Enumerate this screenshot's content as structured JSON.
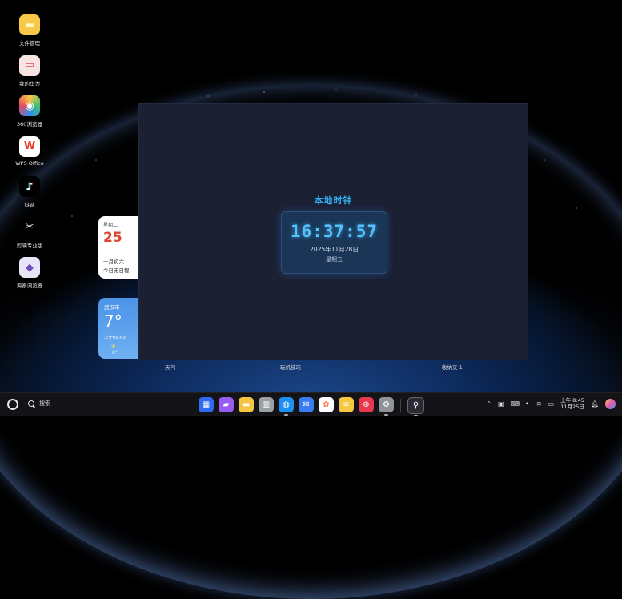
{
  "desktop": {
    "icons": [
      {
        "label": "文件管理",
        "icon": "folder-icon",
        "color": "#f7c948",
        "glyph": "▬"
      },
      {
        "label": "我的华为",
        "icon": "myhuawei-icon",
        "color": "#f7d3d3",
        "glyph": "▭"
      },
      {
        "label": "360浏览器",
        "icon": "360-browser-icon",
        "color": "#ffffff",
        "glyph": "◉"
      },
      {
        "label": "WPS Office",
        "icon": "wps-icon",
        "color": "#e83b2e",
        "glyph": "W"
      },
      {
        "label": "抖音",
        "icon": "douyin-icon",
        "color": "#000000",
        "glyph": "♪"
      },
      {
        "label": "剪映专业版",
        "icon": "capcut-icon",
        "color": "#000000",
        "glyph": "✂"
      },
      {
        "label": "海泰浏览器",
        "icon": "haitai-browser-icon",
        "color": "#6b4fbf",
        "glyph": "◆"
      }
    ]
  },
  "widgets": {
    "calendar": {
      "weekday": "星期二",
      "day": "25",
      "lunar": "十月初六",
      "schedule": "今日无日程"
    },
    "weather": {
      "city": "武汉市",
      "temp": "7°",
      "hour": "上午09:00",
      "hour_temp": "6°"
    },
    "labels": [
      "天气",
      "玩机技巧",
      "收纳夹 1"
    ]
  },
  "clock_app": {
    "title": "本地时钟",
    "time": "16:37:57",
    "date": "2025年11月28日",
    "weekday": "星期五"
  },
  "taskbar": {
    "search_label": "搜索",
    "dock": [
      {
        "icon": "app-gallery-grid-icon",
        "color": "#2f6bf0",
        "glyph": "▦",
        "running": false
      },
      {
        "icon": "files-icon",
        "color": "#9a5cf0",
        "glyph": "▰",
        "running": false
      },
      {
        "icon": "notes-icon",
        "color": "#f6c542",
        "glyph": "▬",
        "running": false
      },
      {
        "icon": "trash-icon",
        "color": "#9aa0a6",
        "glyph": "▥",
        "running": false
      },
      {
        "icon": "browser-icon",
        "color": "#1f8ef1",
        "glyph": "◍",
        "running": true
      },
      {
        "icon": "mail-icon",
        "color": "#3a7df2",
        "glyph": "✉",
        "running": false
      },
      {
        "icon": "photos-icon",
        "color": "#ff7a59",
        "glyph": "✿",
        "running": false
      },
      {
        "icon": "memo-icon",
        "color": "#f5c842",
        "glyph": "≡",
        "running": false
      },
      {
        "icon": "appgallery-icon",
        "color": "#e8384f",
        "glyph": "⊛",
        "running": false
      },
      {
        "icon": "settings-icon",
        "color": "#8e939a",
        "glyph": "⚙",
        "running": true
      },
      {
        "icon": "python-app-icon",
        "color": "#2a2a35",
        "glyph": "⚲",
        "running": true
      }
    ],
    "clock_time": "上午 8:45",
    "clock_date": "11月25日"
  }
}
